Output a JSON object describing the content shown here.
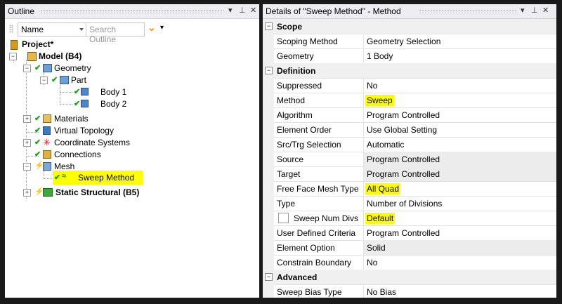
{
  "outline": {
    "title": "Outline",
    "pin": "▕",
    "filter_name": "Name",
    "search_placeholder": "Search Outline",
    "tree": {
      "project": "Project*",
      "model": "Model (B4)",
      "geometry": "Geometry",
      "part": "Part",
      "body1": "Body 1",
      "body2": "Body 2",
      "materials": "Materials",
      "virtual_topology": "Virtual Topology",
      "coordinate_systems": "Coordinate Systems",
      "connections": "Connections",
      "mesh": "Mesh",
      "sweep_method": "Sweep Method",
      "static_structural": "Static Structural (B5)"
    }
  },
  "details": {
    "title": "Details of \"Sweep Method\" - Method",
    "sections": {
      "scope": "Scope",
      "definition": "Definition",
      "advanced": "Advanced"
    },
    "rows": {
      "scoping_method": {
        "key": "Scoping Method",
        "value": "Geometry Selection"
      },
      "geometry": {
        "key": "Geometry",
        "value": "1 Body"
      },
      "suppressed": {
        "key": "Suppressed",
        "value": "No"
      },
      "method": {
        "key": "Method",
        "value": "Sweep"
      },
      "algorithm": {
        "key": "Algorithm",
        "value": "Program Controlled"
      },
      "element_order": {
        "key": "Element Order",
        "value": "Use Global Setting"
      },
      "src_trg": {
        "key": "Src/Trg Selection",
        "value": "Automatic"
      },
      "source": {
        "key": "Source",
        "value": "Program Controlled"
      },
      "target": {
        "key": "Target",
        "value": "Program Controlled"
      },
      "free_face": {
        "key": "Free Face Mesh Type",
        "value": "All Quad"
      },
      "type": {
        "key": "Type",
        "value": "Number of Divisions"
      },
      "sweep_num_divs": {
        "key": "Sweep Num Divs",
        "value": "Default"
      },
      "user_defined": {
        "key": "User Defined Criteria",
        "value": "Program Controlled"
      },
      "element_option": {
        "key": "Element Option",
        "value": "Solid"
      },
      "constrain_boundary": {
        "key": "Constrain Boundary",
        "value": "No"
      },
      "sweep_bias": {
        "key": "Sweep Bias Type",
        "value": "No Bias"
      }
    }
  },
  "colors": {
    "highlight": "#ffff00",
    "check": "#1a9e1a"
  }
}
